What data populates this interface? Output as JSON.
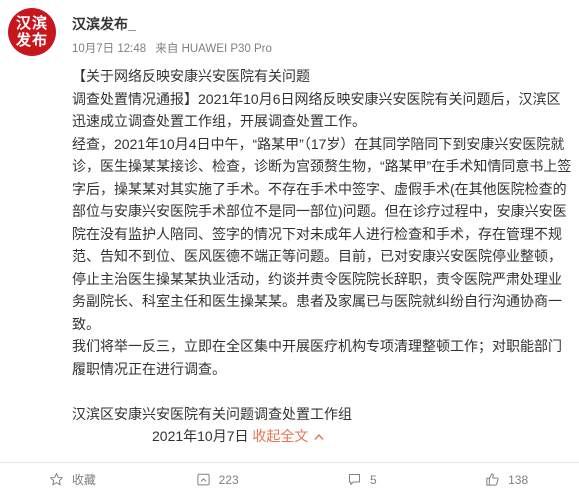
{
  "avatar": {
    "line1": "汉滨",
    "line2": "发布"
  },
  "author": {
    "name": "汉滨发布_"
  },
  "meta": {
    "time": "10月7日 12:48",
    "source": "来自 HUAWEI P30 Pro"
  },
  "post": {
    "title_line1": "【关于网络反映安康兴安医院有关问题",
    "paragraph1": "调查处置情况通报】2021年10月6日网络反映安康兴安医院有关问题后，汉滨区迅速成立调查处置工作组，开展调查处置工作。",
    "paragraph2": "经查，2021年10月4日中午，“路某甲”（17岁）在其同学陪同下到安康兴安医院就诊，医生操某某接诊、检查，诊断为宫颈赘生物，“路某甲”在手术知情同意书上签字后，操某某对其实施了手术。不存在手术中签字、虚假手术(在其他医院检查的部位与安康兴安医院手术部位不是同一部位)问题。但在诊疗过程中，安康兴安医院在没有监护人陪同、签字的情况下对未成年人进行检查和手术，存在管理不规范、告知不到位、医风医德不端正等问题。目前，已对安康兴安医院停业整顿，停止主治医生操某某执业活动，约谈并责令医院院长辞职，责令医院严肃处理业务副院长、科室主任和医生操某某。患者及家属已与医院就纠纷自行沟通协商一致。",
    "paragraph3": "我们将举一反三，立即在全区集中开展医疗机构专项清理整顿工作；对职能部门履职情况正在进行调查。",
    "signature": "汉滨区安康兴安医院有关问题调查处置工作组",
    "date": "2021年10月7日",
    "collapse_label": "收起全文",
    "collapse_icon": "chevron-up-icon"
  },
  "actions": {
    "favorite_label": "收藏",
    "repost_count": "223",
    "comment_count": "5",
    "like_count": "138"
  },
  "colors": {
    "link": "#eb7350",
    "avatar_bg": "#c8161d",
    "meta": "#808080"
  }
}
